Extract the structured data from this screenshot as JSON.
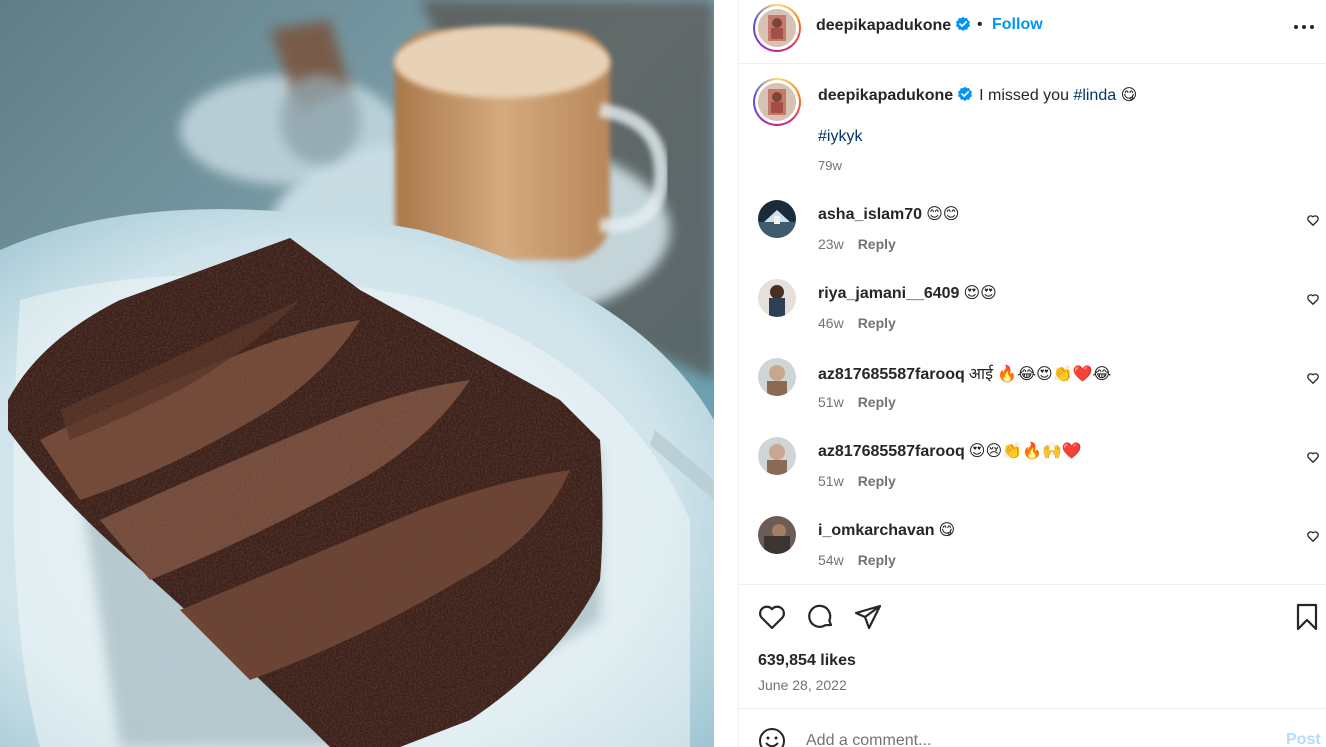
{
  "post": {
    "image_alt": "Slice of layered chocolate cake on a white plate with a glass of latte in the background"
  },
  "header": {
    "username": "deepikapadukone",
    "separator": "•",
    "follow_label": "Follow"
  },
  "caption": {
    "username": "deepikapadukone",
    "text": "I missed you",
    "hashtag1": "#linda",
    "emoji": "😋",
    "hashtag2": "#iykyk",
    "time": "79w"
  },
  "comments": [
    {
      "username": "asha_islam70",
      "text": "😊😊",
      "time": "23w",
      "reply": "Reply"
    },
    {
      "username": "riya_jamani__6409",
      "text": "😍😍",
      "time": "46w",
      "reply": "Reply"
    },
    {
      "username": "az817685587farooq",
      "text": "आई 🔥😂😍👏❤️😂",
      "time": "51w",
      "reply": "Reply"
    },
    {
      "username": "az817685587farooq",
      "text": "😍😢👏🔥🙌❤️",
      "time": "51w",
      "reply": "Reply"
    },
    {
      "username": "i_omkarchavan",
      "text": "😋",
      "time": "54w",
      "reply": "Reply"
    }
  ],
  "engagement": {
    "likes": "639,854 likes",
    "date": "June 28, 2022"
  },
  "add_comment": {
    "placeholder": "Add a comment...",
    "post_label": "Post"
  },
  "colors": {
    "link_blue": "#0095f6",
    "hashtag": "#00376b",
    "secondary_text": "#737373",
    "verified": "#0095f6"
  }
}
